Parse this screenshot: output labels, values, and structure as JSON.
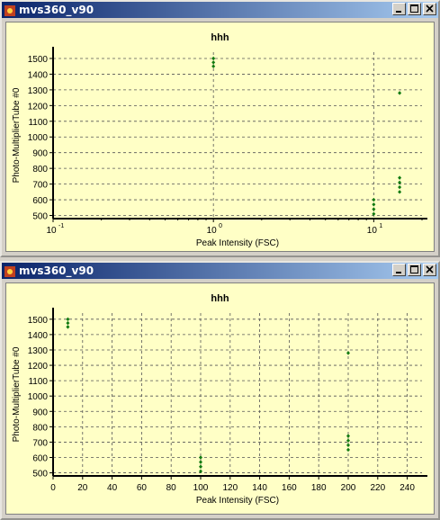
{
  "windows": [
    {
      "title": "mvs360_v90",
      "chart_data": {
        "type": "scatter",
        "title": "hhh",
        "xlabel": "Peak Intensity (FSC)",
        "ylabel": "Photo-MultiplierTube #0",
        "xscale": "log",
        "xlim": [
          0.1,
          20
        ],
        "ylim": [
          480,
          1540
        ],
        "xticks": [
          0.1,
          1,
          10
        ],
        "yticks": [
          500,
          600,
          700,
          800,
          900,
          1000,
          1100,
          1200,
          1300,
          1400,
          1500
        ],
        "grid": true,
        "marker_color": "#107a10",
        "points": [
          {
            "x": 1,
            "y": 1500
          },
          {
            "x": 1,
            "y": 1475
          },
          {
            "x": 1,
            "y": 1450
          },
          {
            "x": 10,
            "y": 600
          },
          {
            "x": 10,
            "y": 570
          },
          {
            "x": 10,
            "y": 540
          },
          {
            "x": 10,
            "y": 510
          },
          {
            "x": 14.5,
            "y": 1280
          },
          {
            "x": 14.5,
            "y": 740
          },
          {
            "x": 14.5,
            "y": 710
          },
          {
            "x": 14.5,
            "y": 680
          },
          {
            "x": 14.5,
            "y": 650
          }
        ]
      }
    },
    {
      "title": "mvs360_v90",
      "chart_data": {
        "type": "scatter",
        "title": "hhh",
        "xlabel": "Peak Intensity (FSC)",
        "ylabel": "Photo-MultiplierTube #0",
        "xscale": "linear",
        "xlim": [
          0,
          250
        ],
        "ylim": [
          480,
          1540
        ],
        "xticks": [
          0,
          20,
          40,
          60,
          80,
          100,
          120,
          140,
          160,
          180,
          200,
          220,
          240
        ],
        "yticks": [
          500,
          600,
          700,
          800,
          900,
          1000,
          1100,
          1200,
          1300,
          1400,
          1500
        ],
        "grid": true,
        "marker_color": "#107a10",
        "points": [
          {
            "x": 10,
            "y": 1500
          },
          {
            "x": 10,
            "y": 1475
          },
          {
            "x": 10,
            "y": 1450
          },
          {
            "x": 100,
            "y": 600
          },
          {
            "x": 100,
            "y": 570
          },
          {
            "x": 100,
            "y": 540
          },
          {
            "x": 100,
            "y": 510
          },
          {
            "x": 200,
            "y": 1280
          },
          {
            "x": 200,
            "y": 740
          },
          {
            "x": 200,
            "y": 710
          },
          {
            "x": 200,
            "y": 680
          },
          {
            "x": 200,
            "y": 650
          }
        ]
      }
    }
  ]
}
